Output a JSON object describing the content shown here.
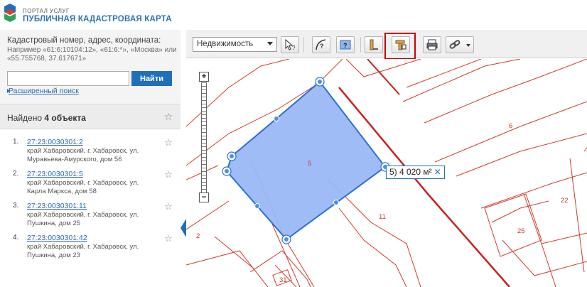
{
  "header": {
    "portal": "ПОРТАЛ УСЛУГ",
    "title": "ПУБЛИЧНАЯ КАДАСТРОВАЯ КАРТА"
  },
  "search": {
    "hint_title": "Кадастровый номер, адрес, координата:",
    "hint_example": "Например «61:6:10104:12», «61:6:*», «Москва» или «55.755768, 37.617671»",
    "input_value": "",
    "button_label": "Найти",
    "advanced_label": "Расширенный поиск"
  },
  "results": {
    "found_prefix": "Найдено ",
    "found_count": "4 объекта",
    "items": [
      {
        "num": "1.",
        "id": "27:23:0030301:2",
        "address": "край Хабаровский, г. Хабаровск, ул. Муравьева-Амурского, дом 56"
      },
      {
        "num": "2.",
        "id": "27:23:0030301:5",
        "address": "край Хабаровский, г. Хабаровск, ул. Карла Маркса, дом 58"
      },
      {
        "num": "3.",
        "id": "27:23:0030301:11",
        "address": "край Хабаровский, г. Хабаровск, ул. Пушкина, дом 25"
      },
      {
        "num": "4.",
        "id": "27:23:0030301:42",
        "address": "край Хабаровский, г. Хабаровск, ул. Пушкина, дом 23"
      }
    ]
  },
  "toolbar": {
    "layer_select": "Недвижимость",
    "tools": [
      "identify-tool",
      "curve-measure-tool",
      "area-identify-tool",
      "distance-tool",
      "area-measure-tool",
      "print-tool",
      "link-tool"
    ],
    "selected_tool": "area-measure-tool"
  },
  "map": {
    "area_label_value": "5) 4 020 м²",
    "close_symbol": "✕",
    "parcel_labels": [
      "5",
      "6",
      "11",
      "2",
      "22",
      "25",
      "31"
    ],
    "colors": {
      "polygon_fill": "#9ab8f5",
      "polygon_stroke": "#2b6fd6",
      "parcel_line": "#d23a2a",
      "road_line": "#cc1f1f",
      "accent": "#1f6fb9"
    }
  }
}
